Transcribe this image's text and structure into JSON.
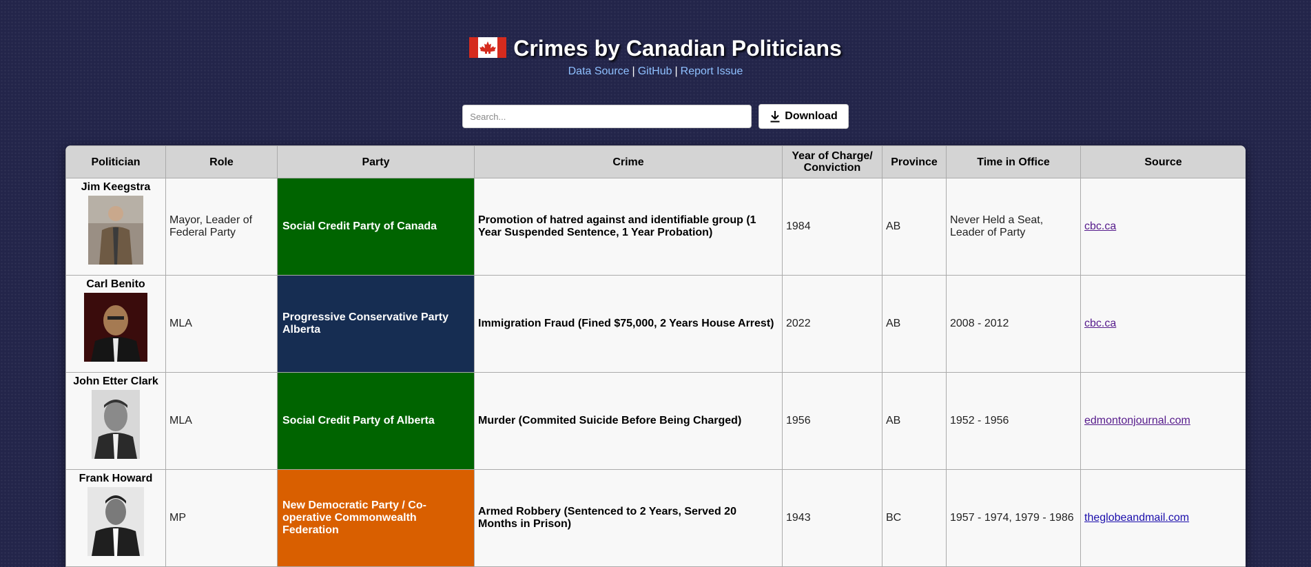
{
  "header": {
    "title": "Crimes by Canadian Politicians",
    "links": [
      "Data Source",
      "GitHub",
      "Report Issue"
    ],
    "separator": "|"
  },
  "controls": {
    "search_placeholder": "Search...",
    "download_label": "Download"
  },
  "table": {
    "columns": [
      "Politician",
      "Role",
      "Party",
      "Crime",
      "Year of Charge/ Conviction",
      "Province",
      "Time in Office",
      "Source"
    ],
    "rows": [
      {
        "politician": "Jim Keegstra",
        "role": "Mayor, Leader of Federal Party",
        "party": "Social Credit Party of Canada",
        "party_color": "#006400",
        "crime": "Promotion of hatred against and identifiable group (1 Year Suspended Sentence, 1 Year Probation)",
        "year": "1984",
        "province": "AB",
        "time_in_office": "Never Held a Seat, Leader of Party",
        "source": "cbc.ca"
      },
      {
        "politician": "Carl Benito",
        "role": "MLA",
        "party": "Progressive Conservative Party Alberta",
        "party_color": "#162d52",
        "crime": "Immigration Fraud (Fined $75,000, 2 Years House Arrest)",
        "year": "2022",
        "province": "AB",
        "time_in_office": "2008 - 2012",
        "source": "cbc.ca"
      },
      {
        "politician": "John Etter Clark",
        "role": "MLA",
        "party": "Social Credit Party of Alberta",
        "party_color": "#006400",
        "crime": "Murder (Commited Suicide Before Being Charged)",
        "year": "1956",
        "province": "AB",
        "time_in_office": "1952 - 1956",
        "source": "edmontonjournal.com"
      },
      {
        "politician": "Frank Howard",
        "role": "MP",
        "party": "New Democratic Party / Co-operative Commonwealth Federation",
        "party_color": "#d95f00",
        "crime": "Armed Robbery (Sentenced to 2 Years, Served 20 Months in Prison)",
        "year": "1943",
        "province": "BC",
        "time_in_office": "1957 - 1974, 1979 - 1986",
        "source": "theglobeandmail.com"
      }
    ]
  }
}
